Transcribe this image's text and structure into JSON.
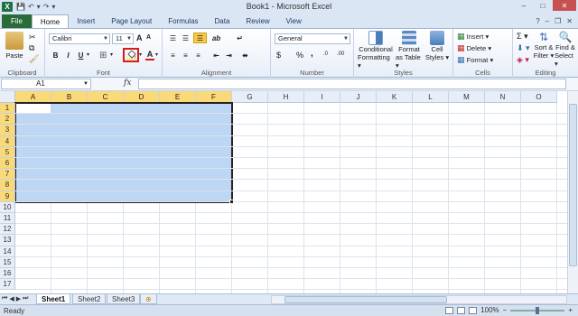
{
  "window": {
    "title": "Book1 - Microsoft Excel",
    "logo_letter": "X",
    "controls": [
      "–",
      "□",
      "✕"
    ]
  },
  "qat": {
    "save": "💾",
    "undo": "↶",
    "redo": "↷",
    "more": "▾"
  },
  "tabs": [
    {
      "label": "File"
    },
    {
      "label": "Home"
    },
    {
      "label": "Insert"
    },
    {
      "label": "Page Layout"
    },
    {
      "label": "Formulas"
    },
    {
      "label": "Data"
    },
    {
      "label": "Review"
    },
    {
      "label": "View"
    }
  ],
  "tab_right": {
    "help": "?",
    "minimize": "–",
    "restore": "❐",
    "close": "✕"
  },
  "ribbon": {
    "clipboard": {
      "label": "Clipboard",
      "paste": "Paste"
    },
    "font": {
      "label": "Font",
      "family": "Calibri",
      "size": "11",
      "grow": "A",
      "shrink": "A",
      "bold": "B",
      "italic": "I",
      "underline": "U"
    },
    "alignment": {
      "label": "Alignment"
    },
    "number": {
      "label": "Number",
      "format": "General",
      "currency": "$",
      "percent": "%",
      "comma": ",",
      "inc": ".0",
      "dec": ".00"
    },
    "styles": {
      "label": "Styles",
      "conditional": "Conditional",
      "conditional2": "Formatting ▾",
      "format_table": "Format",
      "format_table2": "as Table ▾",
      "cell_styles": "Cell",
      "cell_styles2": "Styles ▾"
    },
    "cells": {
      "label": "Cells",
      "insert": "Insert ▾",
      "delete": "Delete ▾",
      "format": "Format ▾"
    },
    "editing": {
      "label": "Editing",
      "sigma": "Σ ▾",
      "sort": "Sort &",
      "sort2": "Filter ▾",
      "find": "Find &",
      "find2": "Select ▾"
    },
    "accent_color": "#d81b1b"
  },
  "formula_bar": {
    "name_box": "A1",
    "fx": "fx",
    "content": ""
  },
  "grid": {
    "columns": [
      "A",
      "B",
      "C",
      "D",
      "E",
      "F",
      "G",
      "H",
      "I",
      "J",
      "K",
      "L",
      "M",
      "N",
      "O"
    ],
    "rows": [
      "1",
      "2",
      "3",
      "4",
      "5",
      "6",
      "7",
      "8",
      "9",
      "10",
      "11",
      "12",
      "13",
      "14",
      "15",
      "16",
      "17"
    ],
    "selected_range": "A1:F9",
    "selection_color": "#bcd6f4",
    "header_highlight": "#f9d978"
  },
  "sheets": [
    {
      "label": "Sheet1",
      "active": true
    },
    {
      "label": "Sheet2",
      "active": false
    },
    {
      "label": "Sheet3",
      "active": false
    }
  ],
  "sheet_nav": [
    "⏮",
    "◀",
    "▶",
    "⏭"
  ],
  "status": {
    "ready": "Ready",
    "zoom": "100%",
    "zoom_out": "−",
    "zoom_in": "+"
  }
}
